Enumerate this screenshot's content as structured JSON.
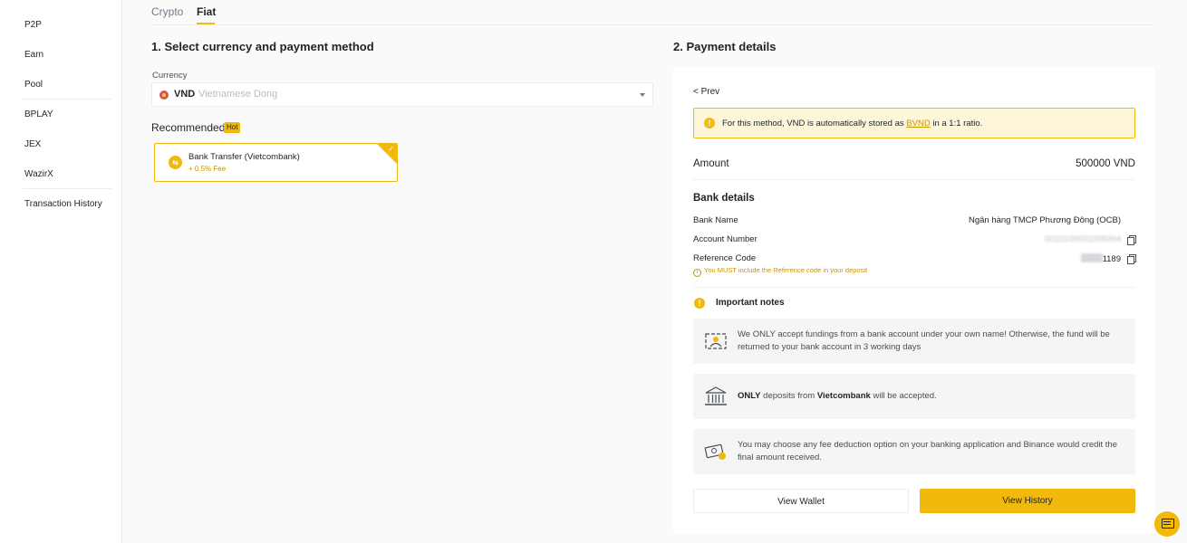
{
  "sidebar": {
    "items": [
      {
        "label": "P2P"
      },
      {
        "label": "Earn"
      },
      {
        "label": "Pool"
      },
      {
        "label": "BPLAY"
      },
      {
        "label": "JEX"
      },
      {
        "label": "WazirX"
      },
      {
        "label": "Transaction History"
      }
    ]
  },
  "tabs": [
    {
      "label": "Crypto",
      "active": false
    },
    {
      "label": "Fiat",
      "active": true
    }
  ],
  "left": {
    "title": "1. Select currency and payment method",
    "currency_label": "Currency",
    "currency_code": "VND",
    "currency_name": "Vietnamese Dong",
    "recommended_label": "Recommended",
    "hot_badge": "Hot",
    "method": {
      "name": "Bank Transfer (Vietcombank)",
      "fee": "+ 0.5% Fee",
      "selected": true
    }
  },
  "right": {
    "title": "2. Payment details",
    "prev": "< Prev",
    "notice": {
      "before": "For this method, VND is automatically stored as ",
      "link": "BVND",
      "after": " in a 1:1 ratio."
    },
    "amount_label": "Amount",
    "amount_value": "500000 VND",
    "bank_details_title": "Bank details",
    "bank_name_label": "Bank Name",
    "bank_name_value": "Ngân hàng TMCP Phương Đông (OCB)",
    "account_number_label": "Account Number",
    "account_number_value": "0010100001005004",
    "reference_code_label": "Reference Code",
    "reference_code_value": "1189",
    "reference_warning": "You MUST include the Reference code in your deposit",
    "important_notes_title": "Important notes",
    "notes": [
      {
        "icon": "id-card-icon",
        "text": "We ONLY accept fundings from a bank account under your own name! Otherwise, the fund will be returned to your bank account in 3 working days"
      },
      {
        "icon": "bank-building-icon",
        "bold1": "ONLY",
        "middle": " deposits from ",
        "bold2": "Vietcombank",
        "end": " will be accepted."
      },
      {
        "icon": "money-exchange-icon",
        "text": "You may choose any fee deduction option on your banking application and Binance would credit the final amount received."
      }
    ],
    "view_wallet": "View Wallet",
    "view_history": "View History"
  },
  "colors": {
    "accent": "#f0b90b",
    "link": "#c99400",
    "notice_bg": "#fef6d8"
  }
}
